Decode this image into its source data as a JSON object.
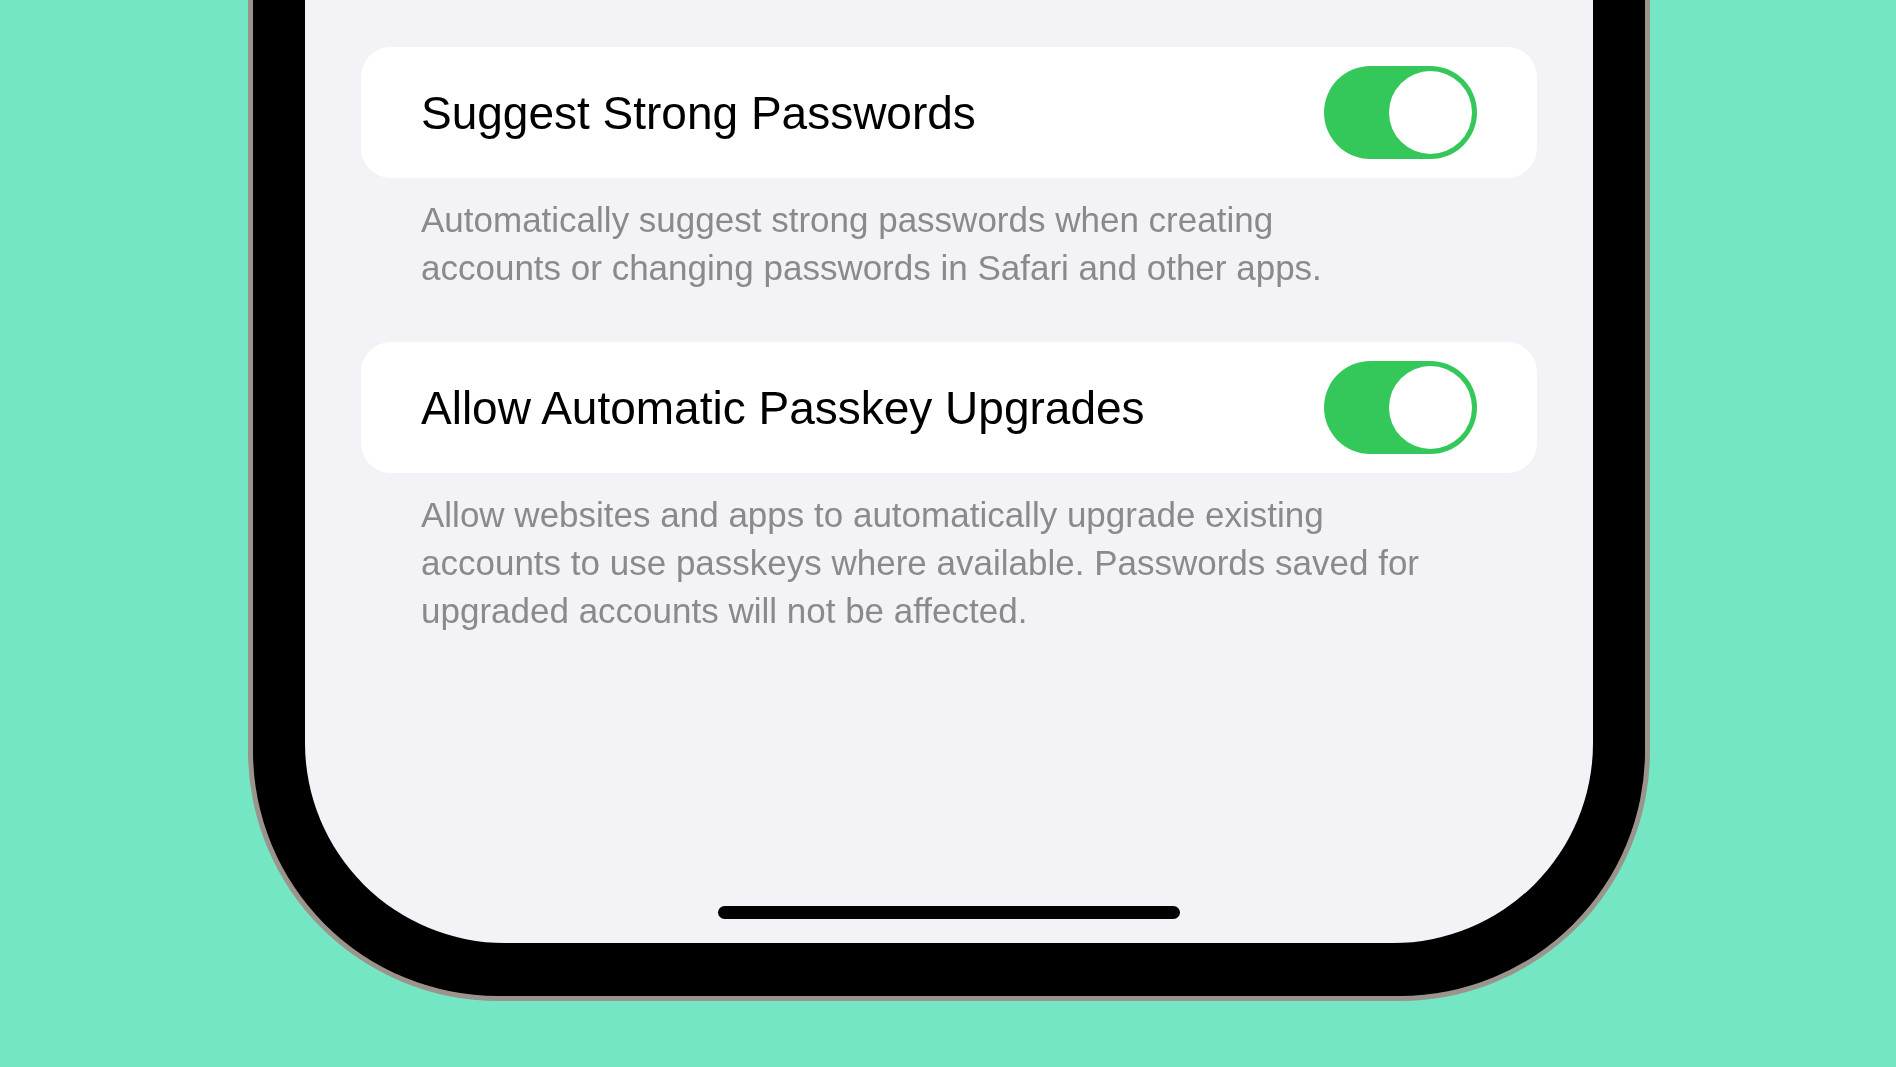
{
  "settings": [
    {
      "label": "Suggest Strong Passwords",
      "on": true,
      "description": "Automatically suggest strong passwords when creating accounts or changing passwords in Safari and other apps."
    },
    {
      "label": "Allow Automatic Passkey Upgrades",
      "on": true,
      "description": "Allow websites and apps to automatically upgrade existing accounts to use passkeys where available. Passwords saved for upgraded accounts will not be affected."
    }
  ]
}
